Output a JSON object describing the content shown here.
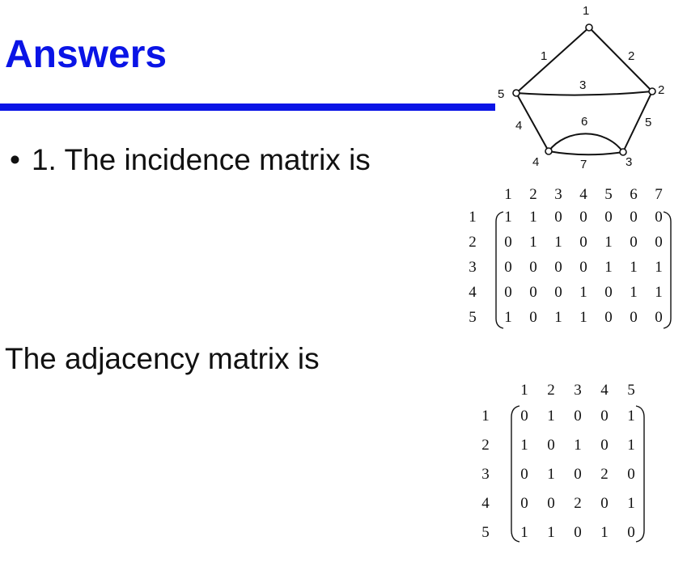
{
  "slide": {
    "title": "Answers",
    "bullet_marker": "•",
    "bullet_text": "1. The incidence matrix is",
    "adjacency_heading": "The adjacency matrix is"
  },
  "graph": {
    "vertices": [
      "1",
      "2",
      "3",
      "4",
      "5"
    ],
    "edges": [
      {
        "label": "1",
        "from": "1",
        "to": "5"
      },
      {
        "label": "2",
        "from": "1",
        "to": "2"
      },
      {
        "label": "3",
        "from": "5",
        "to": "2"
      },
      {
        "label": "4",
        "from": "5",
        "to": "4"
      },
      {
        "label": "5",
        "from": "2",
        "to": "3"
      },
      {
        "label": "6",
        "from": "4",
        "to": "3"
      },
      {
        "label": "7",
        "from": "4",
        "to": "3"
      }
    ]
  },
  "incidence_matrix": {
    "col_headers": [
      "1",
      "2",
      "3",
      "4",
      "5",
      "6",
      "7"
    ],
    "row_headers": [
      "1",
      "2",
      "3",
      "4",
      "5"
    ],
    "rows": [
      [
        "1",
        "1",
        "0",
        "0",
        "0",
        "0",
        "0"
      ],
      [
        "0",
        "1",
        "1",
        "0",
        "1",
        "0",
        "0"
      ],
      [
        "0",
        "0",
        "0",
        "0",
        "1",
        "1",
        "1"
      ],
      [
        "0",
        "0",
        "0",
        "1",
        "0",
        "1",
        "1"
      ],
      [
        "1",
        "0",
        "1",
        "1",
        "0",
        "0",
        "0"
      ]
    ]
  },
  "adjacency_matrix": {
    "col_headers": [
      "1",
      "2",
      "3",
      "4",
      "5"
    ],
    "row_headers": [
      "1",
      "2",
      "3",
      "4",
      "5"
    ],
    "rows": [
      [
        "0",
        "1",
        "0",
        "0",
        "1"
      ],
      [
        "1",
        "0",
        "1",
        "0",
        "1"
      ],
      [
        "0",
        "1",
        "0",
        "2",
        "0"
      ],
      [
        "0",
        "0",
        "2",
        "0",
        "1"
      ],
      [
        "1",
        "1",
        "0",
        "1",
        "0"
      ]
    ]
  }
}
